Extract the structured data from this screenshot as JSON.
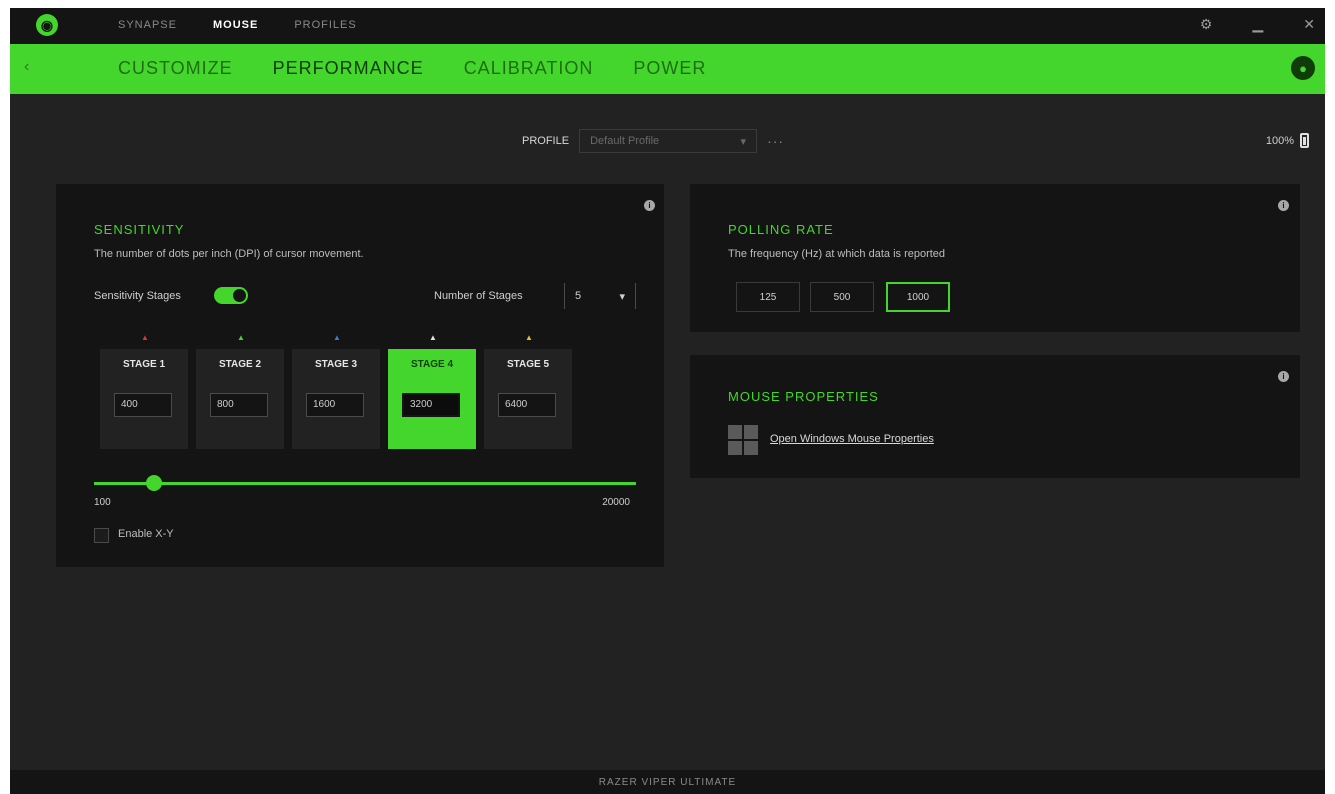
{
  "app": {
    "nav": [
      {
        "label": "SYNAPSE",
        "active": false
      },
      {
        "label": "MOUSE",
        "active": true
      },
      {
        "label": "PROFILES",
        "active": false
      }
    ]
  },
  "tabs": [
    {
      "label": "CUSTOMIZE",
      "active": false
    },
    {
      "label": "PERFORMANCE",
      "active": true
    },
    {
      "label": "CALIBRATION",
      "active": false
    },
    {
      "label": "POWER",
      "active": false
    }
  ],
  "profile": {
    "label": "PROFILE",
    "selected": "Default Profile",
    "more": "···"
  },
  "battery": {
    "label": "100%"
  },
  "sensitivity": {
    "title": "SENSITIVITY",
    "description": "The number of dots per inch (DPI) of cursor movement.",
    "stages_toggle_label": "Sensitivity Stages",
    "stages_count_label": "Number of Stages",
    "stages_count_value": "5",
    "active_stage": 3,
    "stages": [
      {
        "label": "STAGE 1",
        "value": "400",
        "marker_color": "#d13a3a"
      },
      {
        "label": "STAGE 2",
        "value": "800",
        "marker_color": "#44d62c"
      },
      {
        "label": "STAGE 3",
        "value": "1600",
        "marker_color": "#3a7bd5"
      },
      {
        "label": "STAGE 4",
        "value": "3200",
        "marker_color": "#e0e0e0"
      },
      {
        "label": "STAGE 5",
        "value": "6400",
        "marker_color": "#e0c23a"
      }
    ],
    "slider_min": "100",
    "slider_max": "20000",
    "slider_value": 0.11,
    "enable_xy_label": "Enable X-Y"
  },
  "polling": {
    "title": "POLLING RATE",
    "description": "The frequency (Hz) at which data is reported",
    "options": [
      "125",
      "500",
      "1000"
    ],
    "selected_index": 2
  },
  "mouse_properties": {
    "title": "MOUSE PROPERTIES",
    "link": "Open Windows Mouse Properties"
  },
  "footer": {
    "device": "RAZER VIPER ULTIMATE"
  },
  "colors": {
    "accent": "#44d62c",
    "background": "#222222",
    "panel": "#141414"
  },
  "icons": {
    "logo": "razer-logo-icon",
    "settings": "gear-icon",
    "minimize": "minimize-icon",
    "close": "close-icon",
    "back": "back-arrow-icon",
    "avatar": "user-avatar-icon",
    "battery": "battery-icon",
    "info": "info-icon",
    "windows": "windows-logo-icon"
  }
}
